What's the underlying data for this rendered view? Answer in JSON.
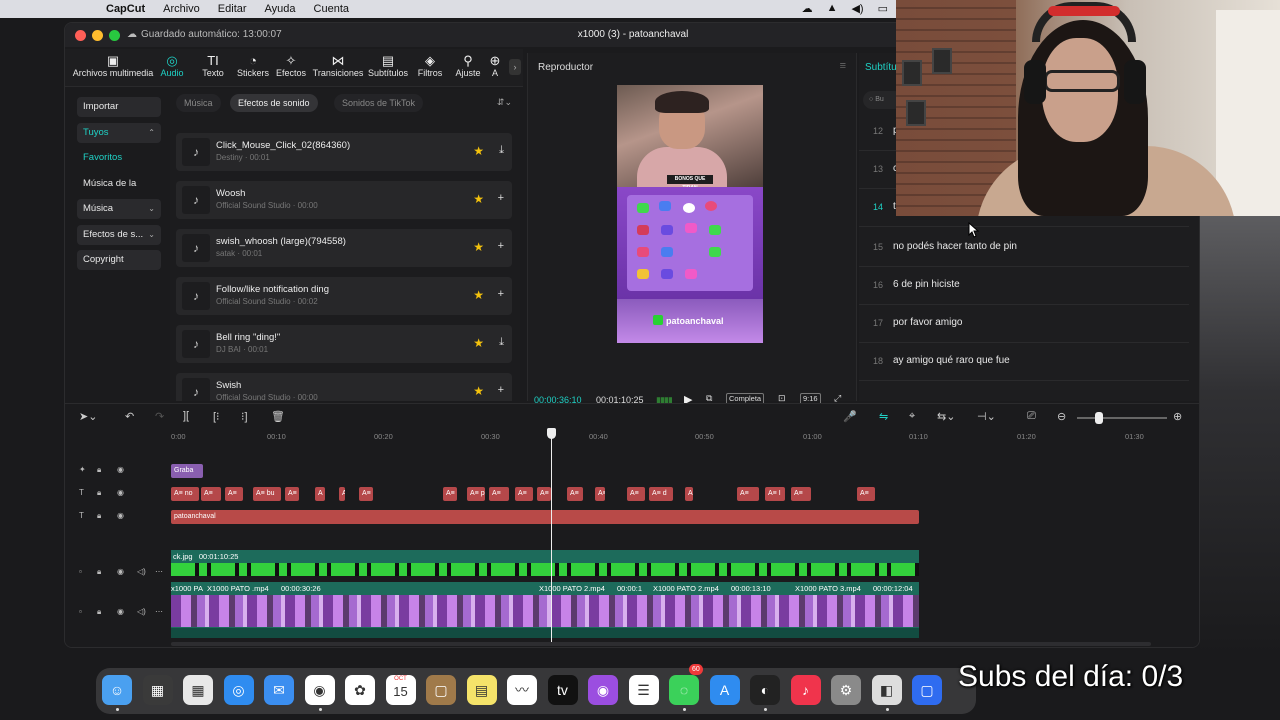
{
  "menubar": {
    "app": "CapCut",
    "items": [
      "Archivo",
      "Editar",
      "Ayuda",
      "Cuenta"
    ]
  },
  "window": {
    "autosave": "Guardado automático: 13:00:07",
    "title": "x1000 (3) - patoanchaval"
  },
  "toolbar": {
    "tools": [
      "Archivos multimedia",
      "Audio",
      "Texto",
      "Stickers",
      "Efectos",
      "Transiciones",
      "Subtítulos",
      "Filtros",
      "Ajuste",
      "A"
    ],
    "active": "Audio"
  },
  "sidebar": {
    "import": "Importar",
    "tuyos": "Tuyos",
    "favoritos": "Favoritos",
    "marca": "Música de la mar...",
    "musica": "Música",
    "efectos": "Efectos de s...",
    "copyright": "Copyright"
  },
  "sounds_panel": {
    "tabs": [
      "Música",
      "Efectos de sonido",
      "Sonidos de TikTok"
    ],
    "active_tab": "Efectos de sonido",
    "items": [
      {
        "name": "Click_Mouse_Click_02(864360)",
        "meta": "Destiny · 00:01",
        "action": "download"
      },
      {
        "name": "Woosh",
        "meta": "Official Sound Studio · 00:00",
        "action": "add"
      },
      {
        "name": "swish_whoosh (large)(794558)",
        "meta": "satak · 00:01",
        "action": "add"
      },
      {
        "name": "Follow/like notification ding",
        "meta": "Official Sound Studio · 00:02",
        "action": "add"
      },
      {
        "name": "Bell ring \"ding!\"",
        "meta": "DJ BAI · 00:01",
        "action": "download"
      },
      {
        "name": "Swish",
        "meta": "Official Sound Studio · 00:00",
        "action": "add"
      }
    ]
  },
  "player": {
    "title": "Reproductor",
    "time_current": "00:00:36:10",
    "time_total": "00:01:10:25",
    "quality": "Completa",
    "ratio": "9:16",
    "preview_banner": "BONOS QUE TIRAN",
    "preview_handle": "patoanchaval"
  },
  "subtitles": {
    "tab": "Subtítu",
    "search_placeholder": "Bu",
    "rows": [
      {
        "n": "12",
        "text": "p"
      },
      {
        "n": "13",
        "text": "c"
      },
      {
        "n": "14",
        "text": "t"
      },
      {
        "n": "15",
        "text": "no podés hacer tanto de pin"
      },
      {
        "n": "16",
        "text": "6 de pin hiciste"
      },
      {
        "n": "17",
        "text": "por favor amigo"
      },
      {
        "n": "18",
        "text": "ay amigo qué raro que fue"
      }
    ],
    "active_row": "14"
  },
  "timeline": {
    "ruler": [
      "0:00",
      "00:10",
      "00:20",
      "00:30",
      "00:40",
      "00:50",
      "01:00",
      "01:10",
      "01:20",
      "01:30"
    ],
    "grabar_clip": "Graba",
    "text_track_label": "patoanchaval",
    "image_clip": "ck.jpg",
    "image_clip_duration": "00:01:10:25",
    "main_clips": [
      "x1000 PA",
      "X1000 PATO .mp4",
      "00:00:30:26",
      "X1000 PATO 2.mp4",
      "00:00:1",
      "X1000 PATO 2.mp4",
      "00:00:13:10",
      "X1000 PATO 3.mp4",
      "00:00:12:04"
    ],
    "text_clips": [
      "A≡ no",
      "A≡",
      "A≡",
      "A≡ bu",
      "A≡",
      "A",
      "A≡",
      "A≡",
      "A≡",
      "A≡ p",
      "A≡",
      "A≡",
      "A≡",
      "A≡",
      "A≡",
      "A≡",
      "A≡ d",
      "A≡",
      "A≡",
      "A≡ I",
      "A≡",
      "A≡"
    ]
  },
  "dock": {
    "apps": [
      "Finder",
      "Calculator",
      "Launchpad",
      "Safari",
      "Mail",
      "Chrome",
      "Photos",
      "Calendar",
      "Notes-brown",
      "Notes",
      "Freeform",
      "Apple TV",
      "Podcasts",
      "Reminders",
      "Messages",
      "App Store",
      "OBS",
      "Music",
      "System Settings",
      "CapCut",
      "Other"
    ],
    "calendar_day": "15",
    "calendar_month": "OCT",
    "tv_label": "tv",
    "messages_badge": "60"
  },
  "overlay": {
    "text": "Subs del día: 0/3"
  },
  "colors": {
    "accent": "#1fd1c5",
    "text_clip": "#b5484a",
    "media_track": "#1d6b5b"
  }
}
